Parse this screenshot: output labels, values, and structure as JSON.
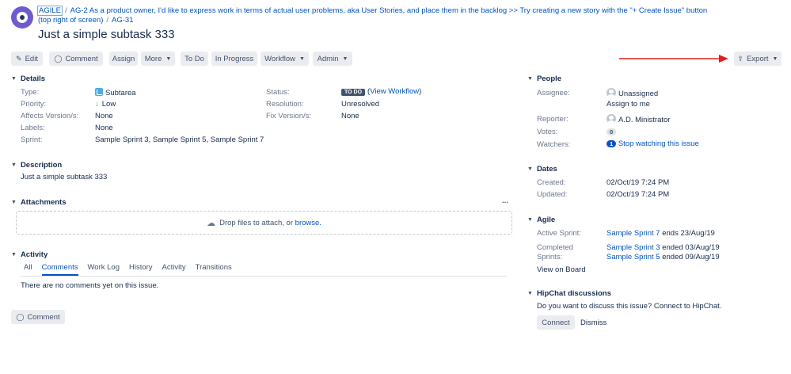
{
  "header": {
    "project_link": "AGILE",
    "parent_link": "AG-2 As a product owner, I'd like to express work in terms of actual user problems, aka User Stories, and place them in the backlog >> Try creating a new story with the \"+ Create Issue\" button (top right of screen)",
    "issue_key": "AG-31",
    "separator": "/",
    "title": "Just a simple subtask 333"
  },
  "toolbar": {
    "edit": "Edit",
    "comment": "Comment",
    "assign": "Assign",
    "more": "More",
    "todo": "To Do",
    "in_progress": "In Progress",
    "workflow": "Workflow",
    "admin": "Admin",
    "export": "Export"
  },
  "details": {
    "heading": "Details",
    "type_label": "Type:",
    "type_value": "Subtarea",
    "priority_label": "Priority:",
    "priority_value": "Low",
    "affects_label": "Affects Version/s:",
    "affects_value": "None",
    "labels_label": "Labels:",
    "labels_value": "None",
    "sprint_label": "Sprint:",
    "sprint_value": "Sample Sprint 3, Sample Sprint 5, Sample Sprint 7",
    "status_label": "Status:",
    "status_badge": "TO DO",
    "status_link": "View Workflow",
    "resolution_label": "Resolution:",
    "resolution_value": "Unresolved",
    "fix_label": "Fix Version/s:",
    "fix_value": "None"
  },
  "description": {
    "heading": "Description",
    "text": "Just a simple subtask 333"
  },
  "attachments": {
    "heading": "Attachments",
    "drop_text": "Drop files to attach, or",
    "browse": "browse.",
    "more": "..."
  },
  "activity": {
    "heading": "Activity",
    "tabs": [
      "All",
      "Comments",
      "Work Log",
      "History",
      "Activity",
      "Transitions"
    ],
    "active_tab": "Comments",
    "empty_text": "There are no comments yet on this issue.",
    "comment_button": "Comment"
  },
  "people": {
    "heading": "People",
    "assignee_label": "Assignee:",
    "assignee_value": "Unassigned",
    "assign_to_me": "Assign to me",
    "reporter_label": "Reporter:",
    "reporter_value": "A.D. Ministrator",
    "votes_label": "Votes:",
    "votes_count": "0",
    "watchers_label": "Watchers:",
    "watchers_count": "1",
    "watch_link": "Stop watching this issue"
  },
  "dates": {
    "heading": "Dates",
    "created_label": "Created:",
    "created_value": "02/Oct/19 7:24 PM",
    "updated_label": "Updated:",
    "updated_value": "02/Oct/19 7:24 PM"
  },
  "agile": {
    "heading": "Agile",
    "active_label": "Active Sprint:",
    "active_link": "Sample Sprint 7",
    "active_suffix": "ends 23/Aug/19",
    "completed_label_1": "Completed",
    "completed_label_2": "Sprints:",
    "completed_1_link": "Sample Sprint 3",
    "completed_1_suffix": "ended 03/Aug/19",
    "completed_2_link": "Sample Sprint 5",
    "completed_2_suffix": "ended 09/Aug/19",
    "view_board": "View on Board"
  },
  "hipchat": {
    "heading": "HipChat discussions",
    "text": "Do you want to discuss this issue? Connect to HipChat.",
    "connect": "Connect",
    "dismiss": "Dismiss"
  },
  "colors": {
    "link": "#0052cc",
    "button_bg": "#ebecf0",
    "badge": "#42526e",
    "arrow": "#e0201b"
  }
}
